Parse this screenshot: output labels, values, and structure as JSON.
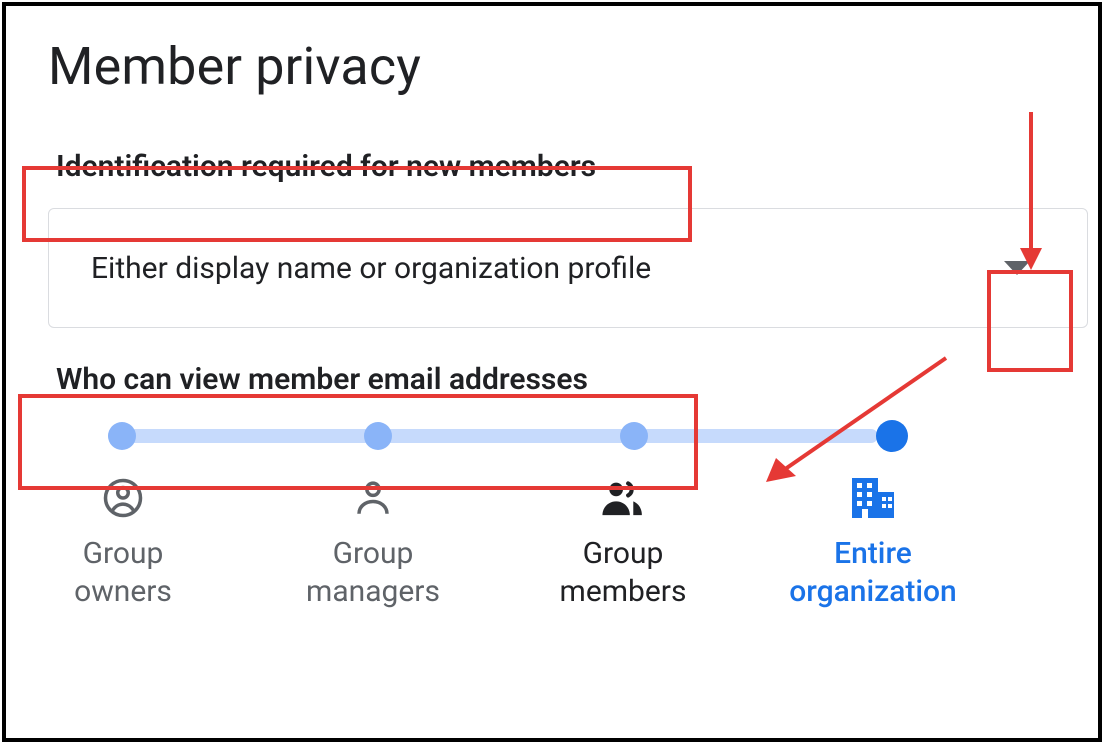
{
  "header": {
    "title": "Member privacy"
  },
  "identification": {
    "label": "Identification required for new members",
    "selected": "Either display name or organization profile"
  },
  "email_view": {
    "label": "Who can view member email addresses",
    "options": [
      {
        "id": "group-owners",
        "label": "Group\nowners"
      },
      {
        "id": "group-managers",
        "label": "Group\nmanagers"
      },
      {
        "id": "group-members",
        "label": "Group\nmembers"
      },
      {
        "id": "entire-organization",
        "label": "Entire\norganization"
      }
    ],
    "selected_index": 3
  },
  "colors": {
    "accent": "#1a73e8",
    "annotation": "#e53935"
  }
}
